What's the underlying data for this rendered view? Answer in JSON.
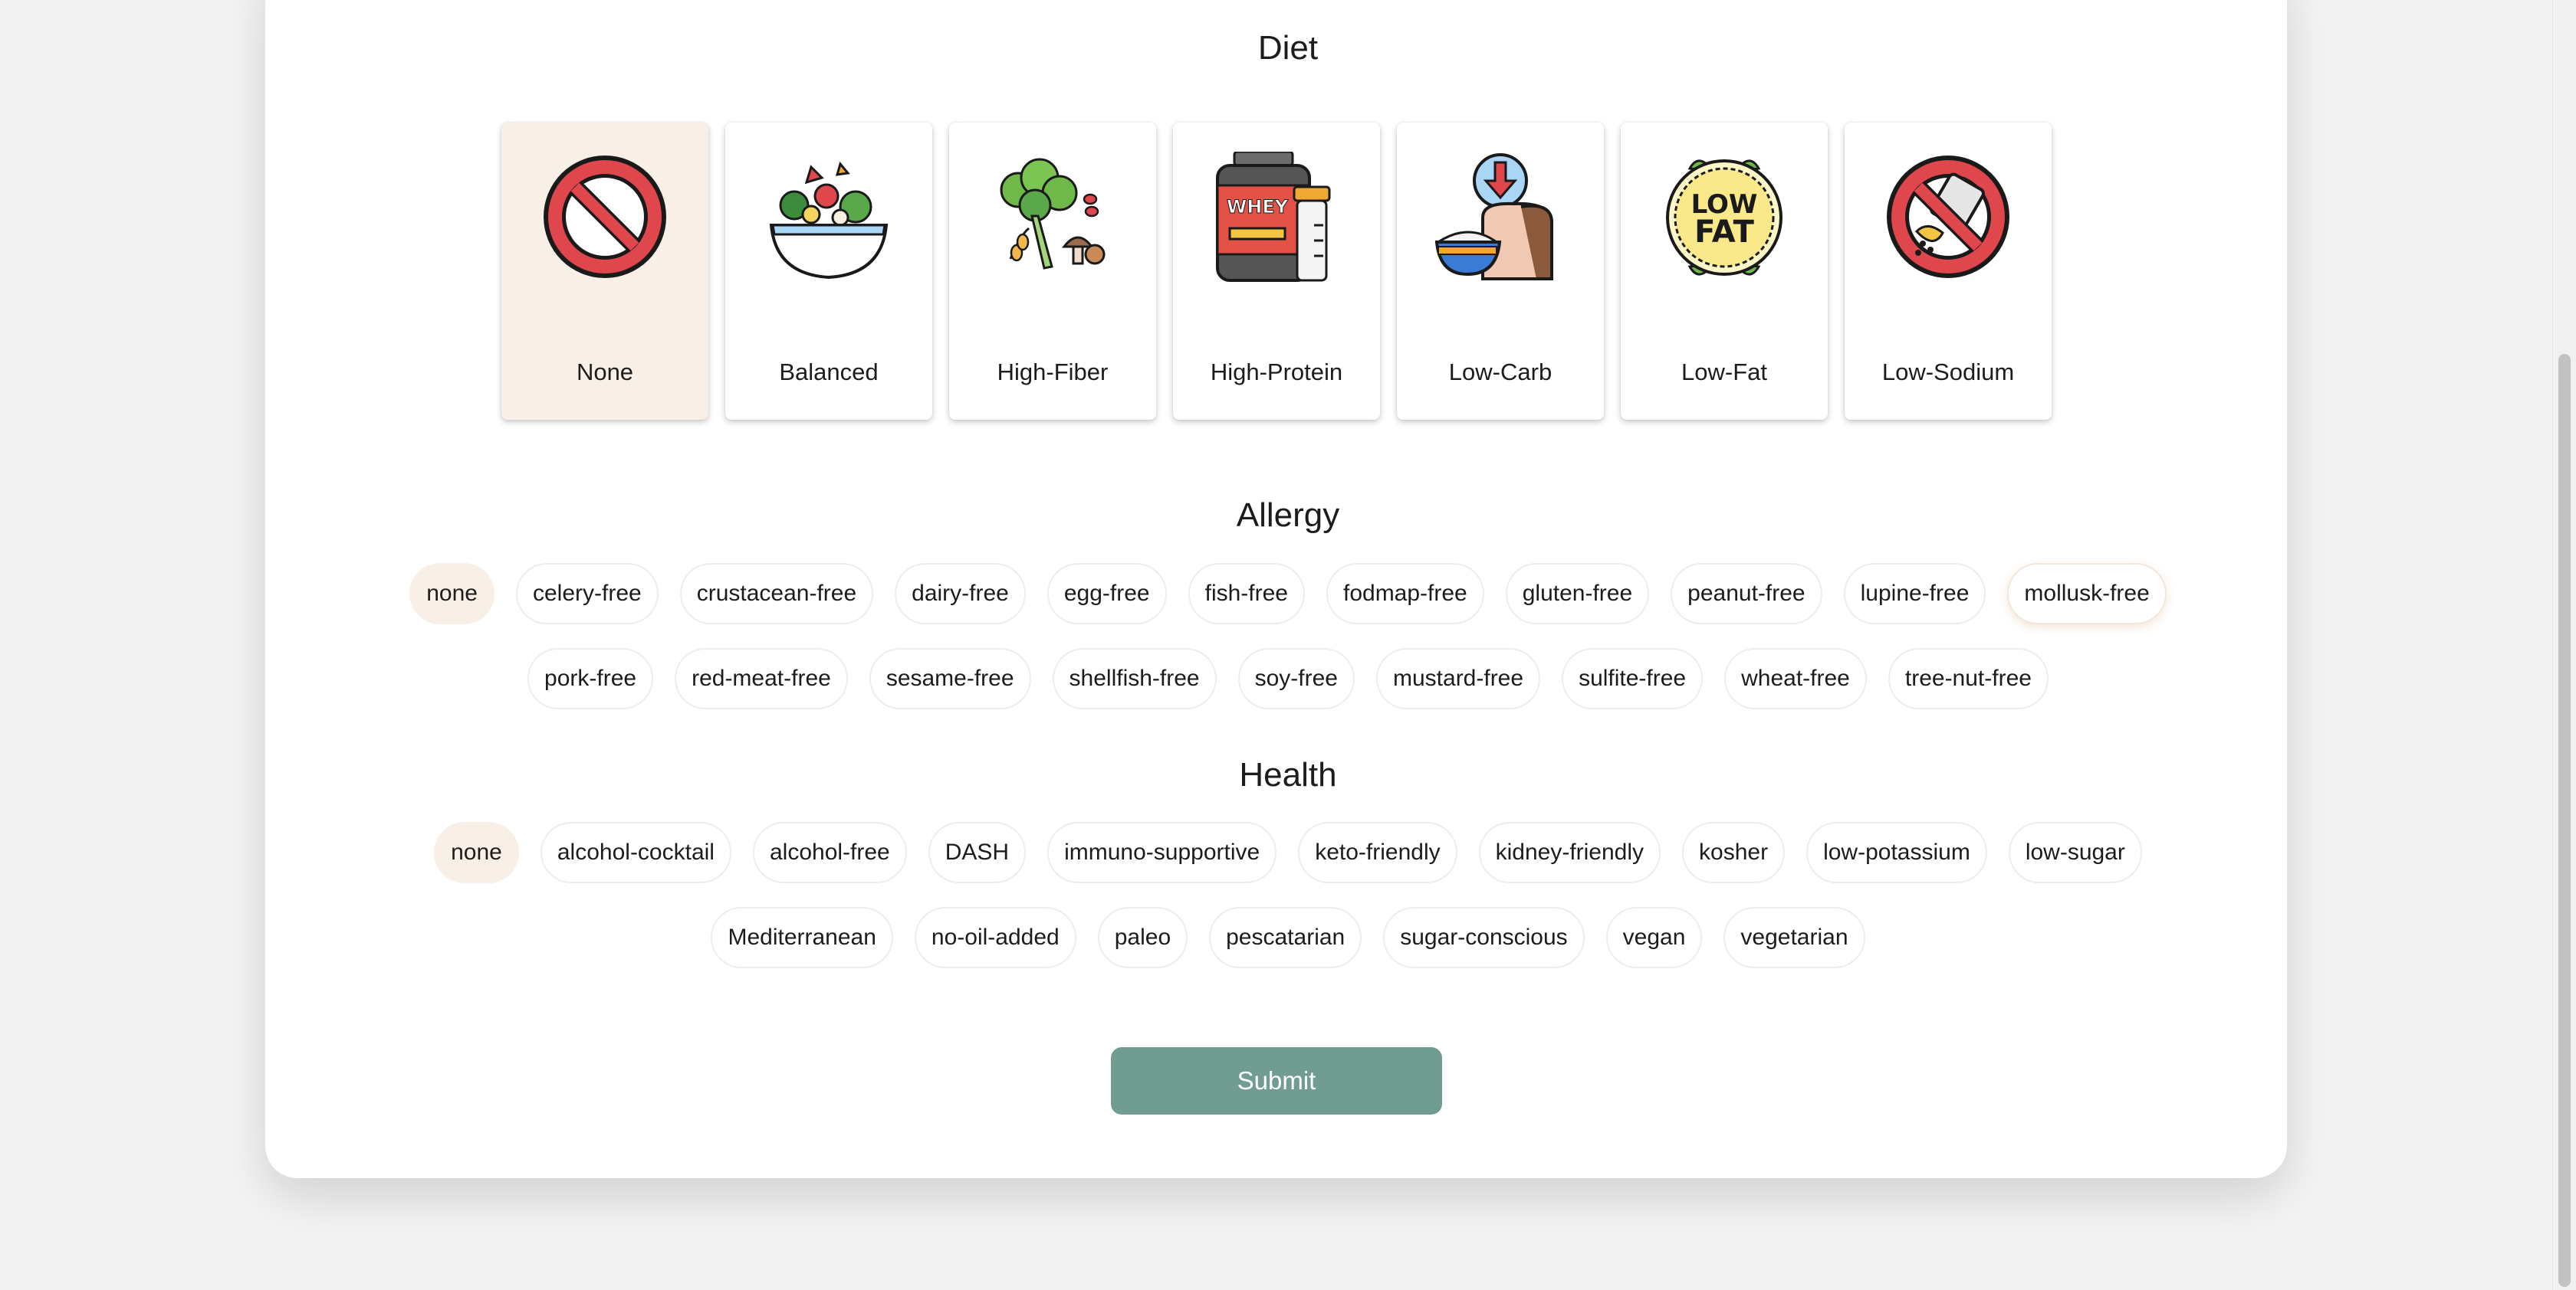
{
  "diet": {
    "title": "Diet",
    "options": [
      {
        "label": "None",
        "icon": "no-entry-icon",
        "selected": true
      },
      {
        "label": "Balanced",
        "icon": "salad-bowl-icon",
        "selected": false
      },
      {
        "label": "High-Fiber",
        "icon": "broccoli-grains-icon",
        "selected": false
      },
      {
        "label": "High-Protein",
        "icon": "whey-protein-icon",
        "selected": false
      },
      {
        "label": "Low-Carb",
        "icon": "bread-rice-down-icon",
        "selected": false
      },
      {
        "label": "Low-Fat",
        "icon": "low-fat-badge-icon",
        "selected": false
      },
      {
        "label": "Low-Sodium",
        "icon": "no-salt-icon",
        "selected": false
      }
    ],
    "low_fat_badge_text": [
      "LOW",
      "FAT"
    ],
    "whey_text": "WHEY"
  },
  "allergy": {
    "title": "Allergy",
    "row1": [
      "none",
      "celery-free",
      "crustacean-free",
      "dairy-free",
      "egg-free",
      "fish-free",
      "fodmap-free",
      "gluten-free",
      "peanut-free",
      "lupine-free",
      "mollusk-free"
    ],
    "row2": [
      "pork-free",
      "red-meat-free",
      "sesame-free",
      "shellfish-free",
      "soy-free",
      "mustard-free",
      "sulfite-free",
      "wheat-free",
      "tree-nut-free"
    ],
    "selected": "none"
  },
  "health": {
    "title": "Health",
    "row1": [
      "none",
      "alcohol-cocktail",
      "alcohol-free",
      "DASH",
      "immuno-supportive",
      "keto-friendly",
      "kidney-friendly",
      "kosher",
      "low-potassium",
      "low-sugar"
    ],
    "row2": [
      "Mediterranean",
      "no-oil-added",
      "paleo",
      "pescatarian",
      "sugar-conscious",
      "vegan",
      "vegetarian"
    ],
    "selected": "none"
  },
  "submit_label": "Submit",
  "colors": {
    "selected_bg": "#f8efe6",
    "submit_bg": "#709c91",
    "page_bg": "#f3f3f3"
  }
}
